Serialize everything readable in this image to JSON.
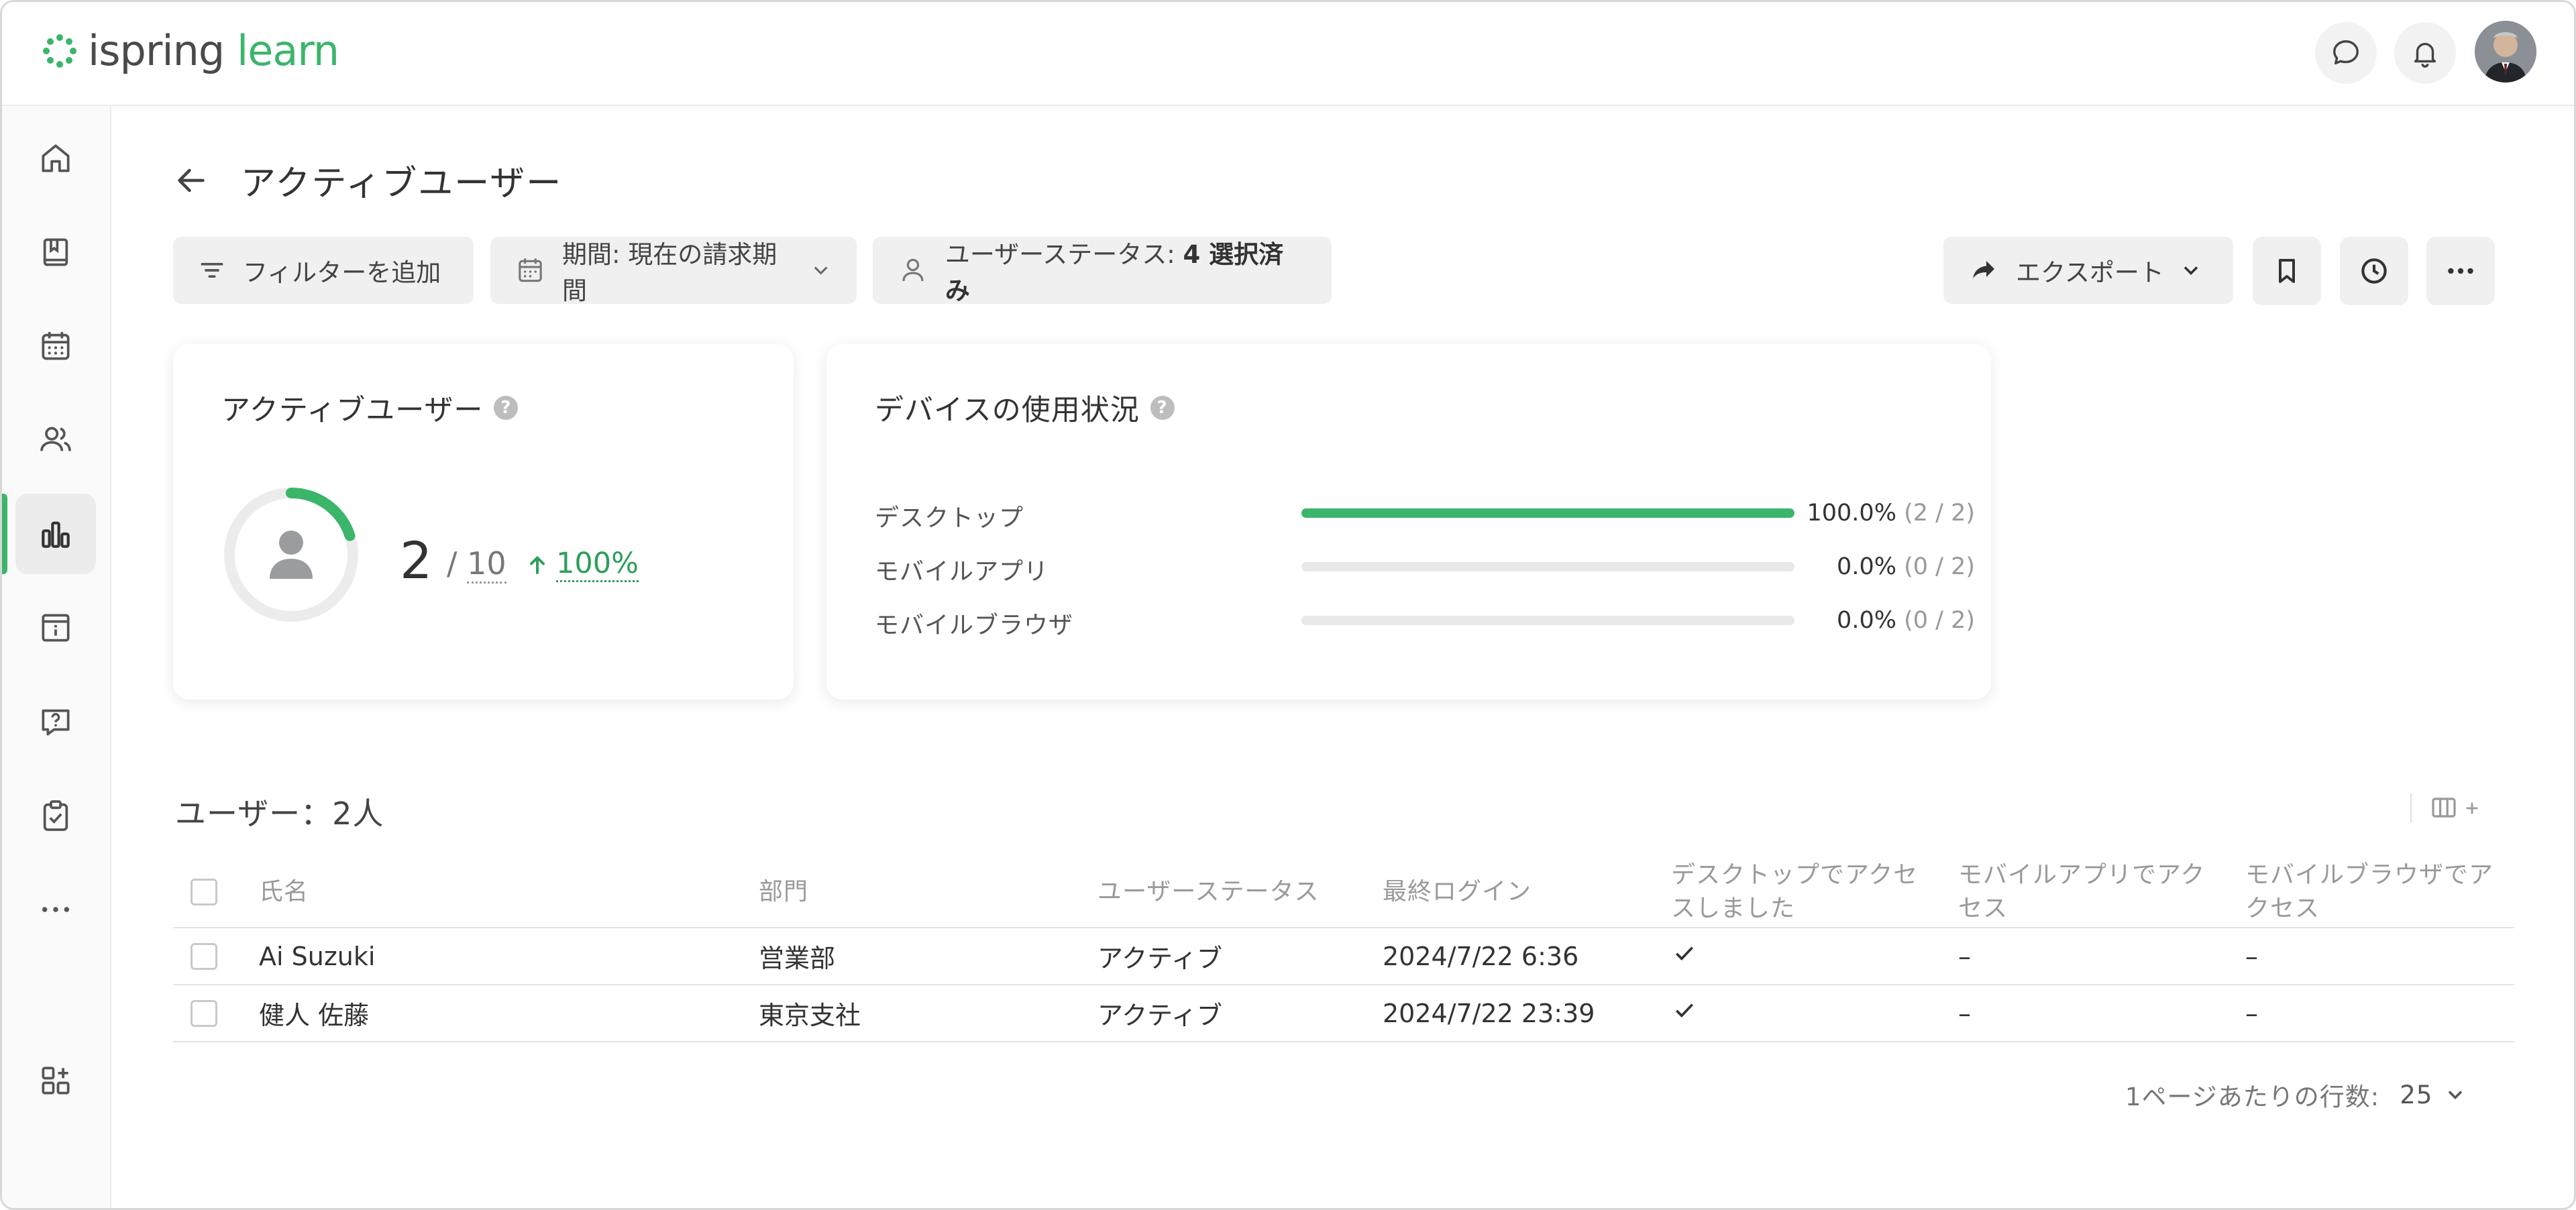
{
  "app": {
    "logo_text_1": "ispring",
    "logo_text_2": "learn",
    "brand_color": "#3bb56a"
  },
  "header": {
    "chat_icon": "chat-bubble-icon",
    "bell_icon": "bell-icon"
  },
  "sidebar": {
    "items": [
      {
        "name": "home",
        "icon": "home-icon"
      },
      {
        "name": "courses",
        "icon": "book-icon"
      },
      {
        "name": "calendar",
        "icon": "calendar-icon"
      },
      {
        "name": "users",
        "icon": "users-icon"
      },
      {
        "name": "reports",
        "icon": "bar-chart-icon",
        "active": true
      },
      {
        "name": "info",
        "icon": "info-board-icon"
      },
      {
        "name": "help",
        "icon": "question-bubble-icon"
      },
      {
        "name": "tasks",
        "icon": "clipboard-check-icon"
      },
      {
        "name": "more",
        "icon": "more-dots-icon"
      },
      {
        "name": "apps",
        "icon": "add-widget-icon"
      }
    ]
  },
  "page": {
    "title": "アクティブユーザー"
  },
  "filters": {
    "add_filter": "フィルターを追加",
    "period_label": "期間: 現在の請求期間",
    "status_prefix": "ユーザーステータス: ",
    "status_value": "4 選択済み"
  },
  "toolbar": {
    "export_label": "エクスポート"
  },
  "active_card": {
    "title": "アクティブユーザー",
    "help": "?",
    "count": "2",
    "separator": "/",
    "total": "10",
    "growth": "100%",
    "ratio": 0.2
  },
  "device_card": {
    "title": "デバイスの使用状況",
    "help": "?",
    "rows": [
      {
        "label": "デスクトップ",
        "percent": "100.0%",
        "fraction": "(2 / 2)",
        "fill": 1.0
      },
      {
        "label": "モバイルアプリ",
        "percent": "0.0%",
        "fraction": "(0 / 2)",
        "fill": 0.0
      },
      {
        "label": "モバイルブラウザ",
        "percent": "0.0%",
        "fraction": "(0 / 2)",
        "fill": 0.0
      }
    ]
  },
  "users": {
    "title": "ユーザー：2人",
    "columns": [
      "氏名",
      "部門",
      "ユーザーステータス",
      "最終ログイン",
      "デスクトップでアクセスしました",
      "モバイルアプリでアクセス",
      "モバイルブラウザでアクセス"
    ],
    "rows": [
      {
        "name": "Ai Suzuki",
        "dept": "営業部",
        "status": "アクティブ",
        "last_login": "2024/7/22 6:36",
        "mobile_app": "–",
        "mobile_browser": "–"
      },
      {
        "name": "健人 佐藤",
        "dept": "東京支社",
        "status": "アクティブ",
        "last_login": "2024/7/22 23:39",
        "mobile_app": "–",
        "mobile_browser": "–"
      }
    ]
  },
  "pager": {
    "label": "1ページあたりの行数:",
    "value": "25"
  }
}
